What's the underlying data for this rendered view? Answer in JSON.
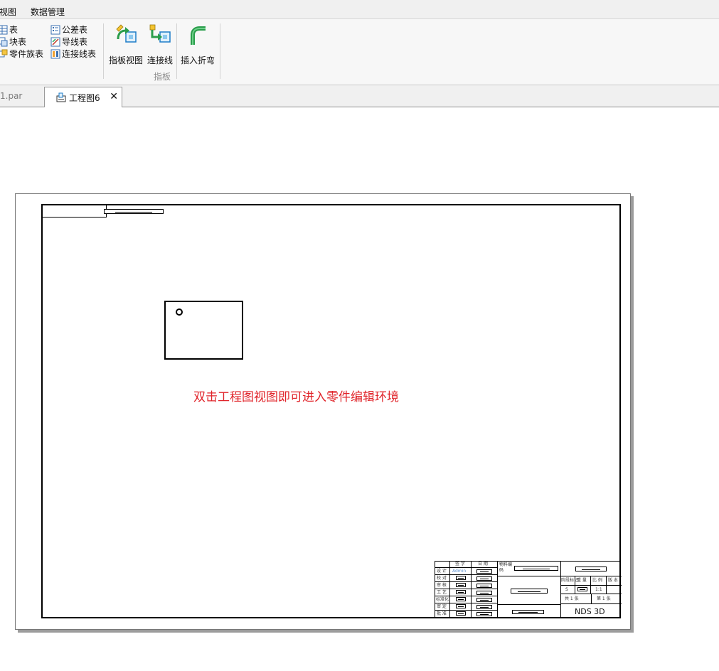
{
  "menubar": {
    "items": [
      "视图",
      "数据管理"
    ]
  },
  "ribbon": {
    "tables_col1": [
      "表",
      "块表",
      "零件族表"
    ],
    "tables_col2": [
      "公差表",
      "导线表",
      "连接线表"
    ],
    "harness_buttons": [
      "指板视图",
      "连接线",
      "插入折弯"
    ],
    "harness_group_label": "指板"
  },
  "tabs": {
    "inactive_label": "1.par",
    "active_label": "工程图6",
    "close_glyph": "✕"
  },
  "drawing": {
    "hint_text": "双击工程图视图即可进入零件编辑环境",
    "title_block": {
      "sign_label": "签 字",
      "date_label": "日 期",
      "material_code_label": "物料编码",
      "design_label": "设 计",
      "design_value": "Admin",
      "check_label": "校 对",
      "review_label": "审 核",
      "process_label": "工 艺",
      "standard_label": "标准化",
      "audit_label": "审 定",
      "approve_label": "批 准",
      "stage_mark_label": "阶段标记",
      "weight_label": "重 量",
      "scale_label": "比 例",
      "version_label": "版 本",
      "stage_value": "S",
      "scale_value": "1:1",
      "sheet_total_label": "共 1 张",
      "sheet_num_label": "第 1 张",
      "company": "NDS 3D"
    }
  },
  "colors": {
    "hint": "#e0242a",
    "ribbon_bg": "#f7f7f7",
    "menubar_bg": "#f0f0f0"
  }
}
